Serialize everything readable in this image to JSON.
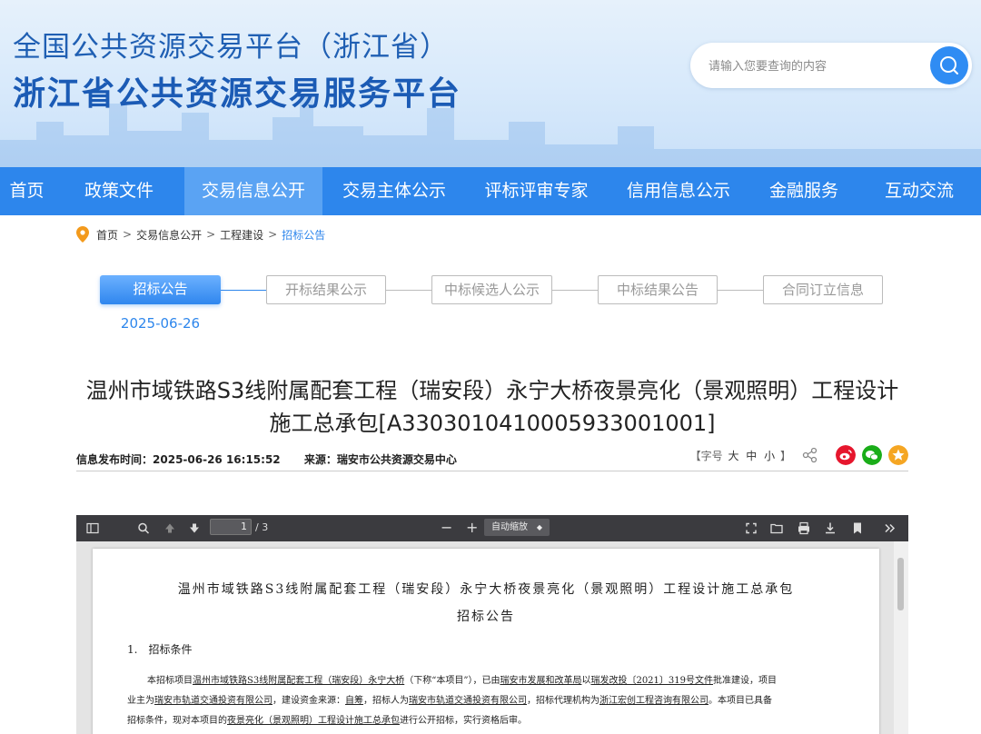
{
  "header": {
    "title_line1": "全国公共资源交易平台（浙江省）",
    "title_line2": "浙江省公共资源交易服务平台",
    "search_placeholder": "请输入您要查询的内容",
    "search_icon": "search-icon"
  },
  "nav": {
    "items": [
      "首页",
      "政策文件",
      "交易信息公开",
      "交易主体公示",
      "评标评审专家",
      "信用信息公示",
      "金融服务",
      "互动交流"
    ],
    "active": "交易信息公开"
  },
  "breadcrumb": {
    "items": [
      "首页",
      "交易信息公开",
      "工程建设",
      "招标公告"
    ],
    "separator": ">"
  },
  "steps": {
    "items": [
      "招标公告",
      "开标结果公示",
      "中标候选人公示",
      "中标结果公告",
      "合同订立信息"
    ],
    "active": "招标公告",
    "active_date": "2025-06-26"
  },
  "article": {
    "title": "温州市域铁路S3线附属配套工程（瑞安段）永宁大桥夜景亮化（景观照明）工程设计施工总承包[A3303010410005933001001]",
    "publish_label": "信息发布时间：",
    "publish_time": "2025-06-26 16:15:52",
    "source_label": "来源：",
    "source": "瑞安市公共资源交易中心",
    "fontsize_open": "【字号",
    "fontsize_large": "大",
    "fontsize_medium": "中",
    "fontsize_small": "小",
    "fontsize_close": "】"
  },
  "pdf_viewer": {
    "page_current": "1",
    "page_total": "/ 3",
    "zoom_minus": "−",
    "zoom_plus": "+",
    "zoom_select": "自动缩放",
    "doc_title": "温州市域铁路S3线附属配套工程（瑞安段）永宁大桥夜景亮化（景观照明）工程设计施工总承包",
    "doc_subtitle": "招标公告",
    "section1": "1.　招标条件",
    "para_a": "本招标项目",
    "para_b": "温州市域铁路S3线附属配套工程（瑞安段）永宁大桥",
    "para_c": "（下称“本项目”），已由",
    "para_d": "瑞安市发展和改革局",
    "para_e": "以",
    "para_f": "瑞发改投〔2021〕319号文件",
    "para_g": "批准建设，项目",
    "para2_a": "业主为",
    "para2_b": "瑞安市轨道交通投资有限公司",
    "para2_c": "，建设资金来源：",
    "para2_d": "自筹",
    "para2_e": "，招标人为",
    "para2_f": "瑞安市轨道交通投资有限公司",
    "para2_g": "，招标代理机构为",
    "para2_h": "浙江宏创工程咨询有限公司",
    "para2_i": "。本项目已具备",
    "para3_a": "招标条件，现对本项目的",
    "para3_b": "夜景亮化（景观照明）工程设计施工总承包",
    "para3_c": "进行公开招标，实行资格后审。"
  },
  "colors": {
    "nav_bg": "#2d86ec",
    "nav_active": "#5aa3f3",
    "accent": "#2d86ec",
    "title_blue": "#1b5bb5",
    "weibo": "#e6162d",
    "wechat": "#1aad19",
    "favorite": "#f5a623"
  }
}
